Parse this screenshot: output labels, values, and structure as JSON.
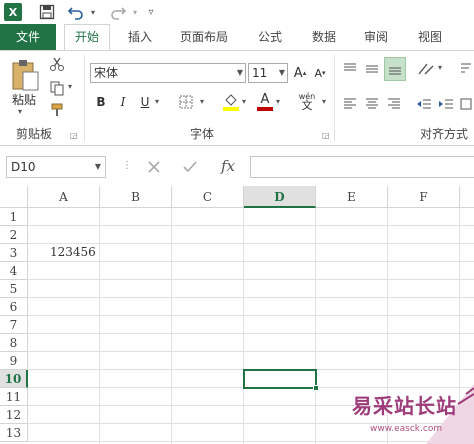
{
  "qat": {
    "app_icon": "excel-icon",
    "save_icon": "save-icon",
    "undo_icon": "undo-icon",
    "redo_icon": "redo-icon"
  },
  "tabs": [
    "文件",
    "开始",
    "插入",
    "页面布局",
    "公式",
    "数据",
    "审阅",
    "视图"
  ],
  "ribbon": {
    "clipboard": {
      "paste_label": "粘贴",
      "group_label": "剪贴板"
    },
    "font": {
      "font_name": "宋体",
      "font_size": "11",
      "group_label": "字体",
      "bold": "B",
      "italic": "I",
      "underline": "U",
      "phonetic": "wén"
    },
    "alignment": {
      "group_label": "对齐方式"
    }
  },
  "formula_bar": {
    "name_box": "D10",
    "fx": "fx",
    "formula": ""
  },
  "columns": [
    "A",
    "B",
    "C",
    "D",
    "E",
    "F"
  ],
  "rows": [
    "1",
    "2",
    "3",
    "4",
    "5",
    "6",
    "7",
    "8",
    "9",
    "10",
    "11",
    "12",
    "13"
  ],
  "cells": {
    "A3": "123456"
  },
  "active_cell": "D10",
  "colors": {
    "accent": "#217346",
    "grid": "#e0e0e0",
    "selected_header": "#e1e1e1"
  },
  "watermark": {
    "cn": "易采站长站",
    "url": "www.easck.com"
  }
}
